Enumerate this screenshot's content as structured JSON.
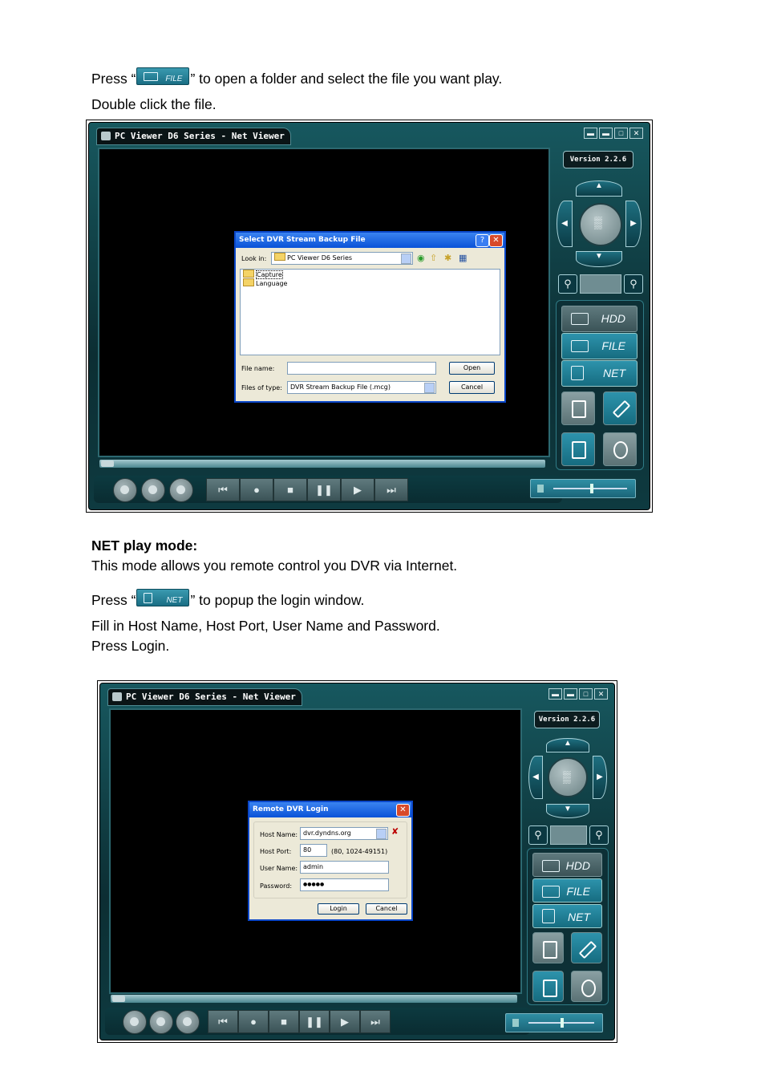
{
  "text": {
    "p1_before": "Press “",
    "p1_after": "” to open a folder and select the file you want play.",
    "p2": "Double click the file.",
    "net_heading": "NET play mode:",
    "net_desc": "This mode allows you remote control you DVR via Internet.",
    "p3_before": "Press “",
    "p3_after": "” to popup the login window.",
    "p4": "Fill in Host Name, Host Port, User Name and Password.",
    "p5": "Press Login."
  },
  "inline_buttons": {
    "file": "FILE",
    "net": "NET"
  },
  "viewer": {
    "title": "PC Viewer D6 Series - Net Viewer",
    "version": "Version 2.2.6",
    "side_buttons": {
      "hdd": "HDD",
      "file": "FILE",
      "net": "NET"
    },
    "window_buttons": [
      "▬",
      "▬",
      "□",
      "✕"
    ],
    "transport": [
      "⏮",
      "●",
      "■",
      "❚❚",
      "▶",
      "⏭"
    ]
  },
  "file_dialog": {
    "title": "Select DVR Stream Backup File",
    "look_in_label": "Look in:",
    "look_in_value": "PC Viewer D6 Series",
    "folders": [
      "Capture",
      "Language"
    ],
    "file_name_label": "File name:",
    "file_name_value": "",
    "files_of_type_label": "Files of type:",
    "files_of_type_value": "DVR Stream Backup File (.mcg)",
    "open_label": "Open",
    "cancel_label": "Cancel"
  },
  "login_dialog": {
    "title": "Remote DVR Login",
    "host_name_label": "Host Name:",
    "host_name_value": "dvr.dyndns.org",
    "host_port_label": "Host Port:",
    "host_port_value": "80",
    "port_hint": "(80, 1024-49151)",
    "user_name_label": "User Name:",
    "user_name_value": "admin",
    "password_label": "Password:",
    "password_value": "●●●●●",
    "login_label": "Login",
    "cancel_label": "Cancel"
  },
  "colors": {
    "accent": "#1a6e84",
    "dialog_title": "#0a52d8",
    "close_red": "#d84a2a"
  }
}
